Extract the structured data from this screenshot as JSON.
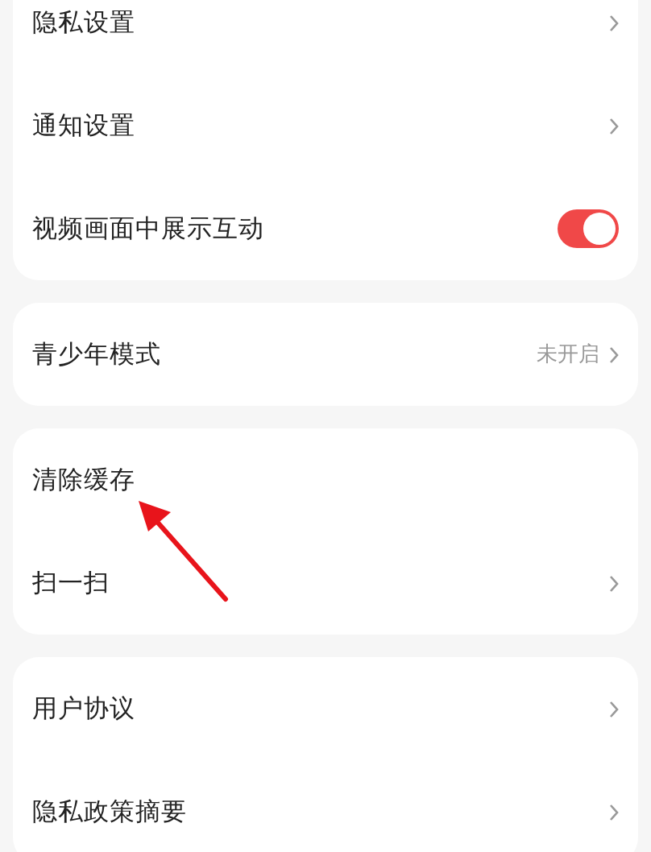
{
  "groups": [
    {
      "items": [
        {
          "kind": "link",
          "label": "隐私设置"
        },
        {
          "kind": "link",
          "label": "通知设置"
        },
        {
          "kind": "toggle",
          "label": "视频画面中展示互动",
          "on": true
        }
      ]
    },
    {
      "items": [
        {
          "kind": "link",
          "label": "青少年模式",
          "value": "未开启"
        }
      ]
    },
    {
      "items": [
        {
          "kind": "plain",
          "label": "清除缓存"
        },
        {
          "kind": "link",
          "label": "扫一扫"
        }
      ]
    },
    {
      "items": [
        {
          "kind": "link",
          "label": "用户协议"
        },
        {
          "kind": "link",
          "label": "隐私政策摘要"
        }
      ]
    }
  ],
  "annotation": {
    "kind": "arrow"
  }
}
